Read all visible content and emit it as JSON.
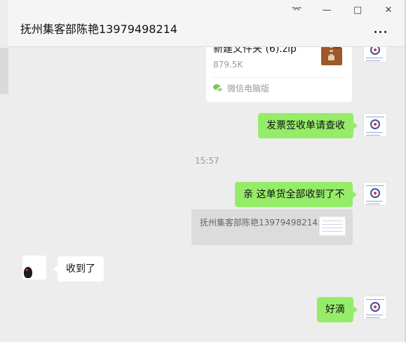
{
  "window": {
    "title": "抚州集客部陈艳13979498214",
    "controls": {
      "pin": "⌤",
      "minimize": "—",
      "maximize": "□",
      "close": "✕"
    }
  },
  "messages": {
    "file": {
      "name": "新建文件夹 (6).zip",
      "size": "879.5K",
      "source": "微信电脑版"
    },
    "m1": "发票签收单请查收",
    "time": "15:57",
    "m2": "亲 这单货全部收到了不",
    "quote": "抚州集客部陈艳13979498214:",
    "m3": "收到了",
    "m4": "好滴"
  },
  "colors": {
    "sent_bubble": "#95ec69",
    "received_bubble": "#ffffff",
    "background": "#ededed"
  },
  "icons": [
    "pin-icon",
    "minimize-icon",
    "maximize-icon",
    "close-icon",
    "more-icon",
    "zip-file-icon",
    "wechat-icon"
  ]
}
